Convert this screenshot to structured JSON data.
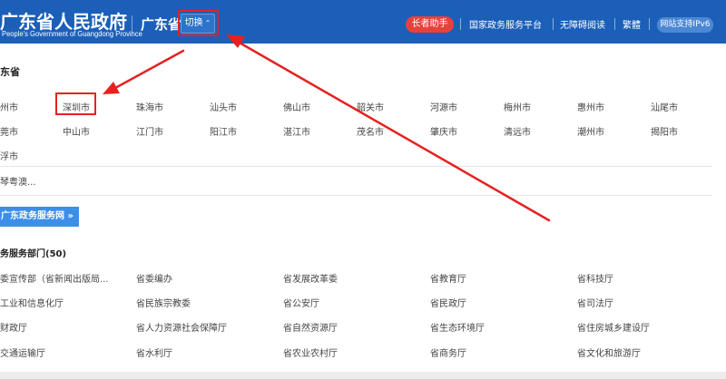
{
  "header": {
    "logo_title": "广东省人民政府",
    "logo_subtitle": "People's Government of Guangdong Province",
    "region": "广东省",
    "switch_label": "切换",
    "elder_label": "长者助手",
    "links": [
      "国家政务服务平台",
      "无障碍阅读",
      "繁體"
    ],
    "ipv6_label": "网站支持IPv6"
  },
  "province": {
    "title": "东省",
    "cities_row1": [
      "州市",
      "深圳市",
      "珠海市",
      "汕头市",
      "佛山市",
      "韶关市",
      "河源市",
      "梅州市",
      "惠州市",
      "汕尾市"
    ],
    "cities_row2": [
      "莞市",
      "中山市",
      "江门市",
      "阳江市",
      "湛江市",
      "茂名市",
      "肇庆市",
      "清远市",
      "潮州市",
      "揭阳市"
    ],
    "cities_row3": [
      "浮市"
    ],
    "other": "琴粤澳..."
  },
  "gd_service_button": "广东政务服务网 »",
  "departments": {
    "title": "务服务部门(50)",
    "rows": [
      [
        "委宣传部（省新闻出版局...",
        "省委编办",
        "省发展改革委",
        "省教育厅",
        "省科技厅"
      ],
      [
        "工业和信息化厅",
        "省民族宗教委",
        "省公安厅",
        "省民政厅",
        "省司法厅"
      ],
      [
        "财政厅",
        "省人力资源社会保障厅",
        "省自然资源厅",
        "省生态环境厅",
        "省住房城乡建设厅"
      ],
      [
        "交通运输厅",
        "省水利厅",
        "省农业农村厅",
        "省商务厅",
        "省文化和旅游厅"
      ]
    ]
  },
  "colors": {
    "header_bg": "#1b5fb8",
    "annotation_red": "#e62121",
    "service_button": "#3d8eea"
  }
}
